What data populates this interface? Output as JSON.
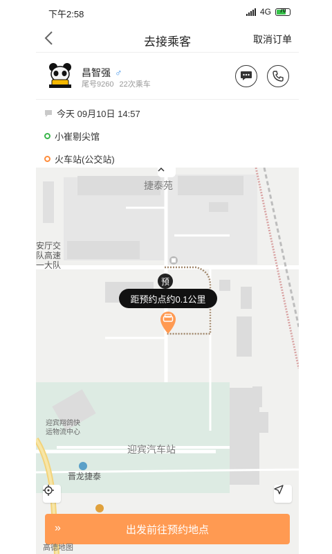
{
  "status": {
    "time": "下午2:58",
    "network": "4G",
    "battery": "70",
    "battery_level": 0.7
  },
  "header": {
    "title": "去接乘客",
    "cancel_label": "取消订单"
  },
  "passenger": {
    "name": "昌智强",
    "gender_icon": "male-icon",
    "tail_number": "尾号9260",
    "ride_count": "22次乘车"
  },
  "order": {
    "time": "今天 09月10日 14:57",
    "start": "小崔剔尖馆",
    "end": "火车站(公交站)"
  },
  "map": {
    "labels": {
      "jietaiyuan": "捷泰苑",
      "police_1": "安厅交",
      "police_2": "队高速",
      "police_3": "一大队",
      "logistics_1": "迎宾翔鸽快",
      "logistics_2": "运物流中心",
      "bus_station": "迎宾汽车站",
      "jinlong": "晋龙捷泰"
    },
    "pre_badge": "预",
    "distance_tip": "距预约点约0.1公里",
    "go_button": "出发前往预约地点",
    "logo_text": "高德地图"
  },
  "colors": {
    "accent": "#ff9a52",
    "green": "#39b54a",
    "orange": "#ff8c3a"
  }
}
